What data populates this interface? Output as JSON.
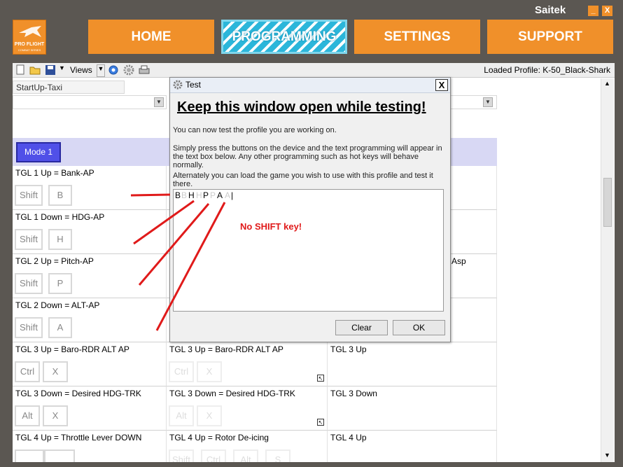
{
  "brand": "Saitek",
  "window_controls": {
    "minimize": "_",
    "close": "X"
  },
  "logo": {
    "line1": "PRO FLIGHT",
    "line2": "COMBAT SERIES"
  },
  "nav": [
    "HOME",
    "PROGRAMMING",
    "SETTINGS",
    "SUPPORT"
  ],
  "active_nav": "PROGRAMMING",
  "toolbar": {
    "views_label": "Views",
    "loaded_profile": "Loaded Profile: K-50_Black-Shark"
  },
  "profile_name": "StartUp-Taxi",
  "mode_button": "Mode 1",
  "rows": [
    {
      "c1": "TGL 1 Up = Bank-AP",
      "c1_keys": [
        "Shift",
        "B"
      ],
      "c2": "",
      "c2_keys": [],
      "c3": ""
    },
    {
      "c1": "TGL 1 Down = HDG-AP",
      "c1_keys": [
        "Shift",
        "H"
      ],
      "c2": "",
      "c2_keys": [],
      "c3": ""
    },
    {
      "c1": "TGL 2 Up = Pitch-AP",
      "c1_keys": [
        "Shift",
        "P"
      ],
      "c2": "",
      "c2_keys": [],
      "c3": "Asp"
    },
    {
      "c1": "TGL 2 Down = ALT-AP",
      "c1_keys": [
        "Shift",
        "A"
      ],
      "c2": "",
      "c2_keys": [],
      "c3": ""
    },
    {
      "c1": "TGL 3 Up = Baro-RDR ALT AP",
      "c1_keys": [
        "Ctrl",
        "X"
      ],
      "c2": "TGL 3 Up = Baro-RDR ALT AP",
      "c2_keys": [
        "Ctrl",
        "X"
      ],
      "c3": "TGL 3 Up"
    },
    {
      "c1": "TGL 3 Down = Desired HDG-TRK",
      "c1_keys": [
        "Alt",
        "X"
      ],
      "c2": "TGL 3 Down = Desired HDG-TRK",
      "c2_keys": [
        "Alt",
        "X"
      ],
      "c3": "TGL 3 Down"
    },
    {
      "c1": "TGL 4 Up = Throttle Lever DOWN",
      "c1_keys": [
        "",
        ""
      ],
      "c2": "TGL 4 Up = Rotor De-icing",
      "c2_keys": [
        "Shift",
        "Ctrl",
        "Alt",
        "S"
      ],
      "c3": "TGL 4 Up"
    }
  ],
  "dialog": {
    "title": "Test",
    "close": "X",
    "heading": "Keep this window open while testing!",
    "para1": "You can now test the profile you are working on.",
    "para2": "Simply press the buttons on the device and the text programming will appear in the text box below. Any other programming such as hot keys will behave normally.",
    "para3": "Alternately you can load the game you wish to use with this profile and test it there.",
    "typed": [
      "B",
      "B",
      "H",
      "H",
      "P",
      "P",
      "A",
      "A",
      "|"
    ],
    "clear_button": "Clear",
    "ok_button": "OK"
  },
  "annotation": "No SHIFT key!",
  "colors": {
    "orange": "#f0902a",
    "mode_blue": "#5050e8",
    "annotation_red": "#e01a1a"
  }
}
